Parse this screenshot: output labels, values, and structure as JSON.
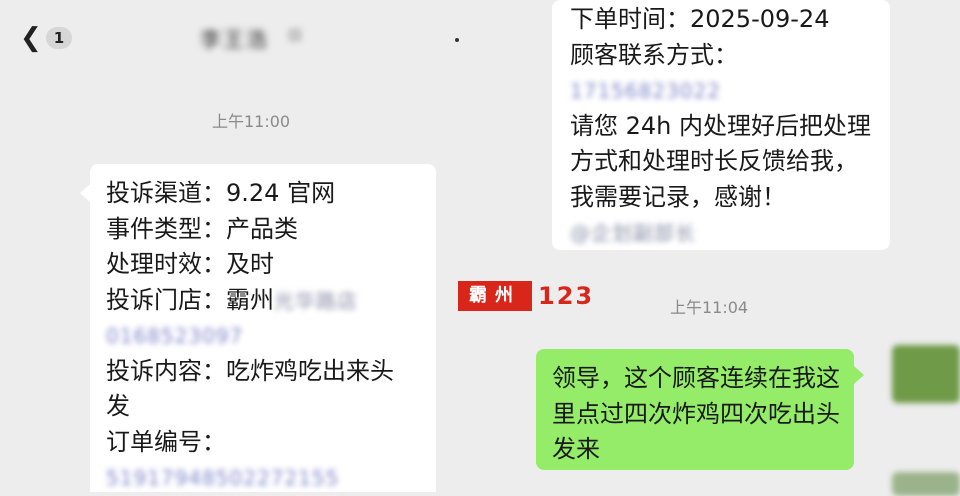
{
  "header": {
    "back_icon": "chevron-left-icon",
    "unread_count": "1",
    "chat_title_blurred": "李王浩",
    "more_dot": "·"
  },
  "left_chat": {
    "timestamp": "上午11:00",
    "complaint_card": {
      "lines": [
        "投诉渠道：9.24 官网",
        "事件类型：产品类",
        "处理时效：及时"
      ],
      "store_label": "投诉门店：霸州",
      "store_blurred": "光华路店",
      "store_phone_blurred": "0168523097",
      "content_line1": "投诉内容：吃炸鸡吃出来头",
      "content_line2": "发",
      "order_label": "订单编号：",
      "order_number_blurred": "51917948502272155"
    }
  },
  "right_chat": {
    "order_card": {
      "order_time": "下单时间：2025-09-24",
      "contact_label": "顾客联系方式：",
      "contact_blurred": "17156823022",
      "request_lines": [
        "请您 24h 内处理好后把处理",
        "方式和处理时长反馈给我，",
        "我需要记录，感谢！"
      ],
      "mention_blurred": "@企划副部长"
    },
    "timestamp": "上午11:04",
    "reply": {
      "lines": [
        "领导，这个顾客连续在我这",
        "里点过四次炸鸡四次吃出头",
        "发来"
      ]
    }
  },
  "watermark": {
    "seal_text": "霸州",
    "number": "123"
  },
  "colors": {
    "background": "#ededed",
    "bubble_white": "#ffffff",
    "bubble_green": "#95ec69",
    "watermark_red": "#d8261a"
  }
}
